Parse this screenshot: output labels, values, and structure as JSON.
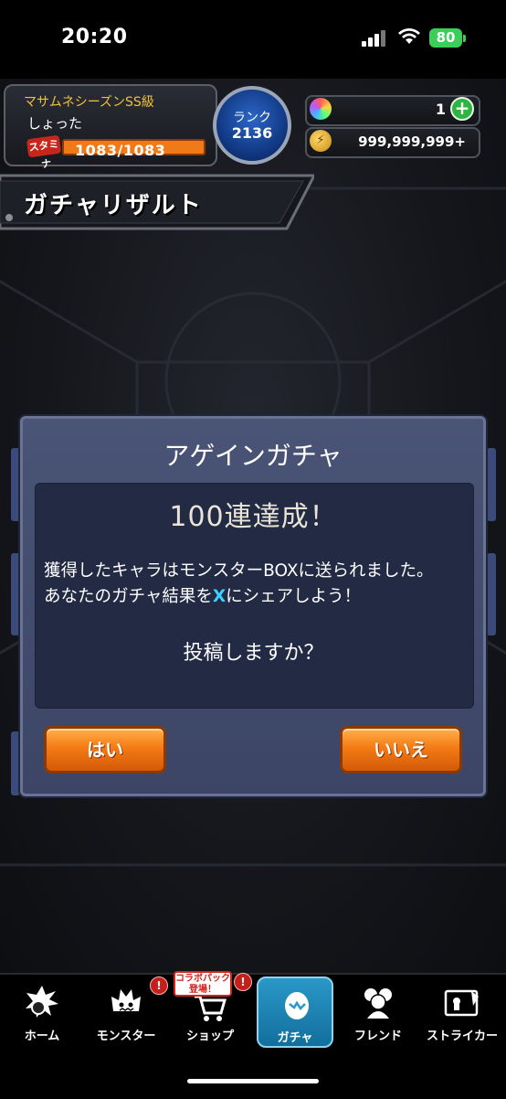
{
  "status_bar": {
    "time": "20:20",
    "battery": "80"
  },
  "player": {
    "title": "マサムネシーズンSS級",
    "name": "しょった",
    "stamina_label": "スタミナ",
    "stamina_text": "1083/1083",
    "stamina_fraction": 1.0,
    "rank_label": "ランク",
    "rank_value": "2136"
  },
  "currency": {
    "orbs": "1",
    "coins": "999,999,999+"
  },
  "screen_title": "ガチャリザルト",
  "dialog": {
    "title": "アゲインガチャ",
    "heading": "100連達成！",
    "message_line1": "獲得したキャラはモンスターBOXに送られました。",
    "message_line2_pre": "あなたのガチャ結果を",
    "message_line2_x": "X",
    "message_line2_post": "にシェアしよう！",
    "question": "投稿しますか？",
    "yes_label": "はい",
    "no_label": "いいえ"
  },
  "nav": {
    "items": [
      {
        "label": "ホーム",
        "icon": "home-explosion-icon"
      },
      {
        "label": "モンスター",
        "icon": "monster-icon"
      },
      {
        "label": "ショップ",
        "icon": "shop-cart-icon"
      },
      {
        "label": "ガチャ",
        "icon": "gacha-egg-icon"
      },
      {
        "label": "フレンド",
        "icon": "friends-icon"
      },
      {
        "label": "ストライカー",
        "icon": "striker-card-icon"
      }
    ],
    "alert": "!",
    "promo_line1": "コラボパック",
    "promo_line2": "登場！"
  },
  "colors": {
    "accent": "#f47b15",
    "active_tab": "#2a98c8",
    "dialog": "#3c4565",
    "gold_text": "#f2c23a"
  }
}
